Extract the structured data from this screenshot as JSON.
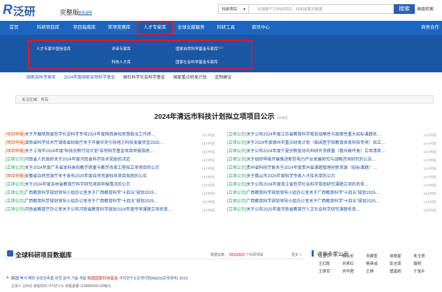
{
  "header": {
    "logo_mark": "R",
    "logo_text": "泛研",
    "edition": "完整版",
    "edition_link": "查看说明",
    "search_select": "科研项目",
    "search_placeholder": "全球数千万科研项目、科研成果大数据",
    "search_button": "搜索",
    "advanced_search": "高级检索"
  },
  "nav": {
    "items": [
      "首页",
      "科研项目库",
      "项目指南库",
      "奖项竞赛库",
      "人才专家库",
      "全球文献服务",
      "科研工具",
      "资讯中心"
    ],
    "active_index": 4,
    "right": "商务合作"
  },
  "mega_menu": {
    "items": [
      {
        "label": "人才专家中国信息库",
        "faded": false
      },
      {
        "label": "评审专家库",
        "faded": false
      },
      {
        "label": "国家自然科学基金专家库",
        "faded": false,
        "badge": "HOT"
      },
      {
        "label": "科技人才库",
        "faded": false
      },
      {
        "label": "国家社会科学基金专家库",
        "faded": false
      }
    ],
    "faded_items": [
      "",
      "",
      "",
      ""
    ]
  },
  "sub_links": [
    "国家自科专家库",
    "2024年度国家自然科学基金",
    "国社科学社会科学基金",
    "国家重点研发计划",
    "定制建议"
  ],
  "filter": {
    "label": "关注区域：所有"
  },
  "headline": {
    "title": "2024年清远市科技计划拟立项项目公示",
    "time": "3分钟前"
  },
  "news_left": [
    {
      "tag": "[项目申报]",
      "tag_color": "orange",
      "title": "关于开展陕西省哲学社会科学专项2024年度陕西高校思想政治工作研…",
      "time": "12小时前"
    },
    {
      "tag": "[项目申报]",
      "tag_color": "orange",
      "title": "湖南省科学技术厅湖南省财政厅关于开展中央引导地方科技发展资金2025…",
      "time": "12小时前"
    },
    {
      "tag": "[项目申报]",
      "tag_color": "orange",
      "title": "关于上海市2024年度“科技创新行动计划”自然科学基金项目申报指南…",
      "time": "12小时前"
    },
    {
      "tag": "[立项公示]",
      "tag_color": "green",
      "title": "河南省人民政府关于2024年度河南省科学技术奖励的决定",
      "time": "12小时前"
    },
    {
      "tag": "[立项公示]",
      "tag_color": "green",
      "title": "关于2024年度广东省本科高校教学质量与教学改革工程拟立项项目的公示",
      "time": "12小时前"
    },
    {
      "tag": "[项目申报]",
      "tag_color": "orange",
      "title": "安徽省自然资源厅关于发布2025年度自然资源科技项目指南的公告",
      "time": "12小时前"
    },
    {
      "tag": "[立项公示]",
      "tag_color": "green",
      "title": "关于2024年度吉林省教育厅科学研究项目申报情况的公示",
      "time": "12小时前"
    },
    {
      "tag": "[立项公示]",
      "tag_color": "green",
      "title": "广西教育科学规划领导小组办公室关于广西教育科学“十四五”规划2025…",
      "time": "12小时前"
    },
    {
      "tag": "[立项公示]",
      "tag_color": "green",
      "title": "广西教育科学规划领导小组办公室关于广西教育科学“十四五”规划2025…",
      "time": "12小时前"
    },
    {
      "tag": "[立项公示]",
      "tag_color": "green",
      "title": "河南省教育厅办公室关于公布河南省教育科学规划2024年度专项课题立项名单…",
      "time": "12小时前"
    }
  ],
  "news_right": [
    {
      "tag": "[立项公示]",
      "tag_color": "green",
      "title": "关于公布2024年度江苏省教育科学规划战略性与政策性重大招标课题名…",
      "time": "12小时前"
    },
    {
      "tag": "[立项公示]",
      "tag_color": "green",
      "title": "关于2024年度德州市重点研发计划（临床医学和教育体育科技专项）拟立…",
      "time": "12小时前"
    },
    {
      "tag": "[立项公示]",
      "tag_color": "green",
      "title": "关于公布2024年度宁夏创新驱动与科研外资质量（惠州高坪类）立项清单…",
      "time": "12小时前"
    },
    {
      "tag": "[立项公示]",
      "tag_color": "green",
      "title": "关于组织申报开展推进新型电力产业发展研究与战略咨询研究的公告…",
      "time": "12小时前"
    },
    {
      "tag": "[立项公示]",
      "tag_color": "green",
      "title": "贵州省科技厅联关于2024年度贵州省课题管理创新资源（招标课题）…",
      "time": "12小时前"
    },
    {
      "tag": "[立项公示]",
      "tag_color": "green",
      "title": "关于佛山市2025年度科学专家人才库名单的公示",
      "time": "12小时前"
    },
    {
      "tag": "[立项公示]",
      "tag_color": "green",
      "title": "关于公布2024年度浙江省哲学社会科学规划研究课题立项的名单…",
      "time": "12小时前"
    },
    {
      "tag": "[立项公示]",
      "tag_color": "green",
      "title": "广西教育科学规划领导小组办公室关于广西教育科学“十四五”规划2025…",
      "time": "12小时前"
    },
    {
      "tag": "[立项公示]",
      "tag_color": "green",
      "title": "广西教育科学规划领导小组办公室关于广西教育科学“十四五”规划2025…",
      "time": "12小时前"
    },
    {
      "tag": "[立项公示]",
      "tag_color": "green",
      "title": "关于公布2025年度河南省教育厅人文社会科学研究课题名单…",
      "time": "12小时前"
    }
  ],
  "database": {
    "title": "全球科研项目数据库",
    "info_prefix": "数据总数：",
    "count": "59112920",
    "info_suffix": "个科研项目",
    "more": "更多 >",
    "entry_prefix": "韩国",
    "entry_title": "북극 해빙 위성관측을 위한 분석 기술 개발",
    "entry_tag": "韩国国家科技基金",
    "entry_org": "극지연구소운영지원(R&D)(운영경비) 2019",
    "meta": "主持人:김희웅 承担机构:극지연구소 资助金额:1148680000.00韩元"
  },
  "experts": {
    "title": "评审专家公示",
    "names": [
      "张显宇",
      "叙云伦",
      "何建宽",
      "徐艳星",
      "朱玉贤",
      "王红胜",
      "刘青红",
      "杨恭成",
      "彭志荣",
      "聂明",
      "王焕军",
      "刘华君",
      "王峥",
      "管昌辉",
      "于张卉"
    ]
  }
}
